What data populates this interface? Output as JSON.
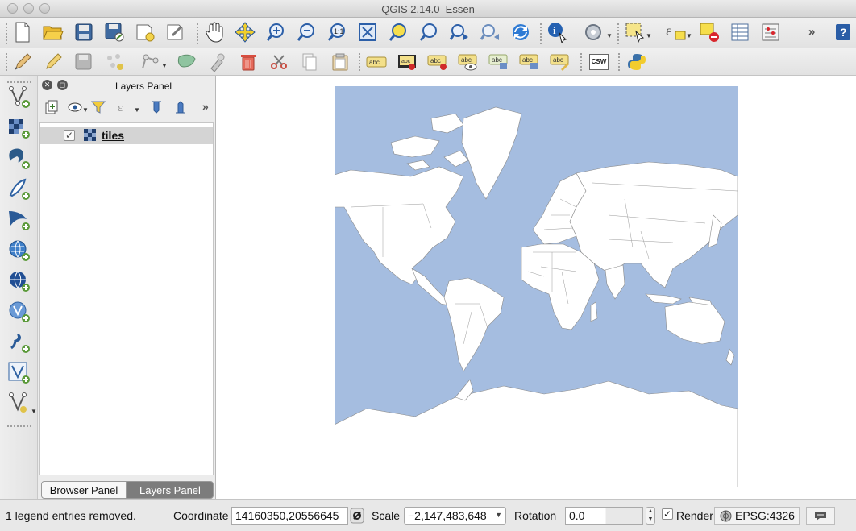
{
  "window": {
    "title": "QGIS 2.14.0–Essen"
  },
  "toolbar_row1": {
    "icons": [
      "new-project-icon",
      "open-project-icon",
      "save-project-icon",
      "save-as-icon",
      "new-print-composer-icon",
      "composer-manager-icon",
      "pan-icon",
      "pan-to-selection-icon",
      "zoom-in-icon",
      "zoom-out-icon",
      "zoom-actual-icon",
      "zoom-full-icon",
      "zoom-to-selection-icon",
      "zoom-to-layer-icon",
      "zoom-last-icon",
      "zoom-next-icon",
      "refresh-icon",
      "identify-icon",
      "run-action-icon",
      "select-features-icon",
      "select-by-expression-icon",
      "deselect-icon",
      "attribute-table-icon",
      "field-calculator-icon",
      "map-tips-icon"
    ]
  },
  "toolbar_row2": {
    "icons": [
      "digitize-icon",
      "toggle-editing-icon",
      "save-edits-icon",
      "add-feature-icon",
      "move-feature-icon",
      "node-tool-icon",
      "delete-selected-icon",
      "cut-features-icon",
      "copy-features-icon",
      "paste-features-icon",
      "label-icon",
      "highlight-pinned-labels-icon",
      "pin-labels-icon",
      "show-hide-labels-icon",
      "move-label-icon",
      "rotate-label-icon",
      "change-label-icon",
      "csw-icon",
      "python-console-icon"
    ],
    "csw_label": "CSW"
  },
  "left_toolbar": {
    "icons": [
      "add-vector-layer-icon",
      "add-raster-layer-icon",
      "add-postgis-layer-icon",
      "add-spatialite-layer-icon",
      "add-mssql-layer-icon",
      "add-wms-layer-icon",
      "add-wcs-layer-icon",
      "add-wfs-layer-icon",
      "add-delimited-text-layer-icon",
      "add-virtual-layer-icon",
      "new-shapefile-layer-icon"
    ]
  },
  "layers_panel": {
    "title": "Layers Panel",
    "layers": [
      {
        "name": "tiles",
        "checked": true
      }
    ],
    "tabs": [
      "Browser Panel",
      "Layers Panel"
    ],
    "active_tab": "Layers Panel"
  },
  "colors": {
    "ocean": "#a5bde0",
    "land": "#ffffff",
    "border": "#8a8a8a"
  },
  "status_bar": {
    "message": "1 legend entries removed.",
    "coordinate_label": "Coordinate",
    "coordinate_value": "14160350,20556645",
    "scale_label": "Scale",
    "scale_value": "−2,147,483,648",
    "rotation_label": "Rotation",
    "rotation_value": "0.0",
    "render_label": "Render",
    "render_checked": true,
    "crs": "EPSG:4326"
  }
}
